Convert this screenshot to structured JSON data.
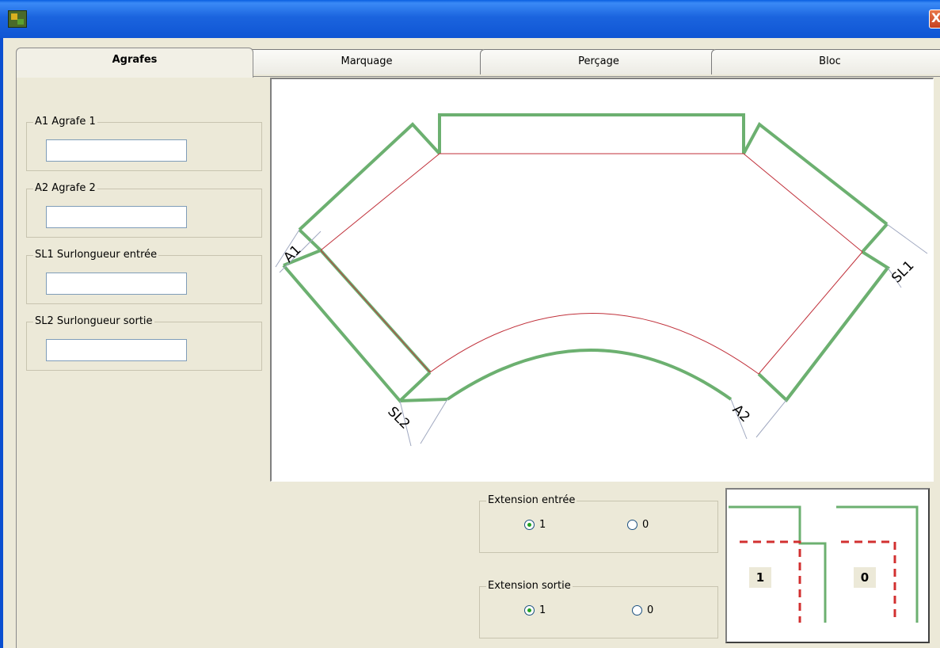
{
  "window": {
    "title": "",
    "close_glyph": "X"
  },
  "tabs": [
    {
      "label": "Agrafes",
      "active": true
    },
    {
      "label": "Marquage",
      "active": false
    },
    {
      "label": "Perçage",
      "active": false
    },
    {
      "label": "Bloc",
      "active": false
    }
  ],
  "fields": [
    {
      "label": "A1 Agrafe 1",
      "value": ""
    },
    {
      "label": "A2 Agrafe 2",
      "value": ""
    },
    {
      "label": "SL1 Surlongueur entrée",
      "value": ""
    },
    {
      "label": "SL2 Surlongueur sortie",
      "value": ""
    }
  ],
  "diagram": {
    "labels": {
      "a1": "A1",
      "a2": "A2",
      "sl1": "SL1",
      "sl2": "SL2"
    },
    "colors": {
      "outline": "#6cb070",
      "centerline": "#c0303a",
      "dimension": "#a0a8c0"
    }
  },
  "extension_entree": {
    "label": "Extension entrée",
    "options": [
      {
        "label": "1",
        "checked": true
      },
      {
        "label": "0",
        "checked": false
      }
    ]
  },
  "extension_sortie": {
    "label": "Extension sortie",
    "options": [
      {
        "label": "1",
        "checked": true
      },
      {
        "label": "0",
        "checked": false
      }
    ]
  },
  "preview": {
    "label_left": "1",
    "label_right": "0"
  },
  "colors": {
    "titlebar": "#1b64de",
    "background": "#ece9d8",
    "radio_dot": "#21a121"
  }
}
